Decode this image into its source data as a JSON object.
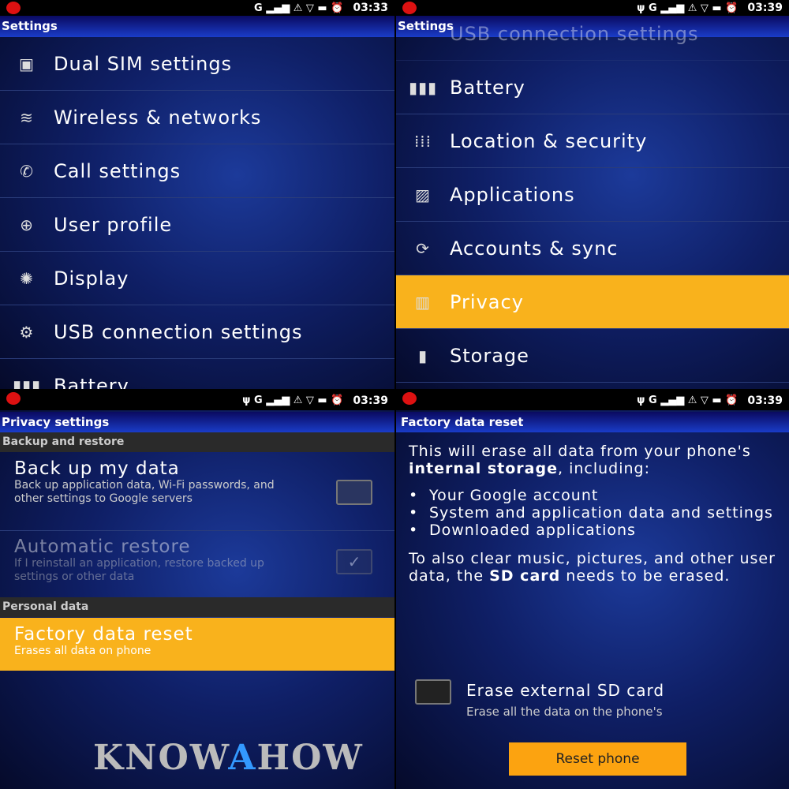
{
  "status_bars": [
    {
      "time": "03:33",
      "network": "G"
    },
    {
      "time": "03:39",
      "network": "G"
    },
    {
      "time": "03:39",
      "network": "G"
    },
    {
      "time": "03:39",
      "network": "G"
    }
  ],
  "settings1": {
    "title": "Settings",
    "items": [
      {
        "label": "Dual SIM settings",
        "icon": "sim-icon",
        "glyph": "▣"
      },
      {
        "label": "Wireless & networks",
        "icon": "wifi-icon",
        "glyph": "≋"
      },
      {
        "label": "Call settings",
        "icon": "phone-icon",
        "glyph": "✆"
      },
      {
        "label": "User profile",
        "icon": "profile-icon",
        "glyph": "⊕"
      },
      {
        "label": "Display",
        "icon": "display-icon",
        "glyph": "✺"
      },
      {
        "label": "USB connection settings",
        "icon": "usb-icon",
        "glyph": "⚙"
      },
      {
        "label": "Battery",
        "icon": "battery-icon",
        "glyph": "▮▮▮"
      }
    ]
  },
  "settings2": {
    "title": "Settings",
    "partial_item": "USB connection settings",
    "items": [
      {
        "label": "Battery",
        "icon": "battery-icon",
        "glyph": "▮▮▮"
      },
      {
        "label": "Location & security",
        "icon": "location-icon",
        "glyph": "⁞⁞⁞"
      },
      {
        "label": "Applications",
        "icon": "applications-icon",
        "glyph": "▨"
      },
      {
        "label": "Accounts & sync",
        "icon": "sync-icon",
        "glyph": "⟳"
      },
      {
        "label": "Privacy",
        "icon": "privacy-icon",
        "glyph": "▥",
        "selected": true
      },
      {
        "label": "Storage",
        "icon": "storage-icon",
        "glyph": "▮"
      }
    ]
  },
  "privacy": {
    "title": "Privacy settings",
    "section1": "Backup and restore",
    "backup": {
      "title": "Back up my data",
      "desc": "Back up application data, Wi-Fi passwords, and other settings to Google servers",
      "checked": false
    },
    "restore": {
      "title": "Automatic restore",
      "desc": "If I reinstall an application, restore backed up settings or other data",
      "checked": true,
      "disabled": true
    },
    "section2": "Personal data",
    "factory": {
      "title": "Factory data reset",
      "desc": "Erases all data on phone"
    },
    "watermark": "KnowAHow"
  },
  "reset": {
    "title": "Factory data reset",
    "intro_a": "This will erase all data from your phone's ",
    "intro_bold": "internal storage",
    "intro_b": ", including:",
    "bullets": [
      "Your Google account",
      "System and application data and settings",
      "Downloaded applications"
    ],
    "outro_a": "To also clear music, pictures, and other user data, the ",
    "outro_bold": "SD card",
    "outro_b": " needs to be erased.",
    "erase_sd": {
      "title": "Erase external SD card",
      "desc": "Erase all the data on the phone's",
      "checked": false
    },
    "button": "Reset phone"
  },
  "colors": {
    "accent": "#f9b21c",
    "title_bar": "#1a3cc8"
  }
}
